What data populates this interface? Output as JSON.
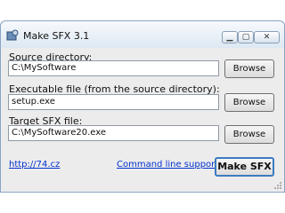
{
  "window": {
    "title": "Make SFX 3.1",
    "icons": {
      "app": "gear-app-icon",
      "minimize": "minimize-icon",
      "maximize": "maximize-icon",
      "close": "close-icon"
    }
  },
  "source": {
    "label": "Source directory:",
    "value": "C:\\MySoftware",
    "browse_label": "Browse"
  },
  "executable": {
    "label": "Executable file (from the source directory):",
    "value": "setup.exe",
    "browse_label": "Browse"
  },
  "target": {
    "label": "Target SFX file:",
    "value": "C:\\MySoftware20.exe",
    "browse_label": "Browse"
  },
  "footer": {
    "website_link": "http://74.cz",
    "command_line_link": "Command line support",
    "make_button": "Make SFX"
  }
}
